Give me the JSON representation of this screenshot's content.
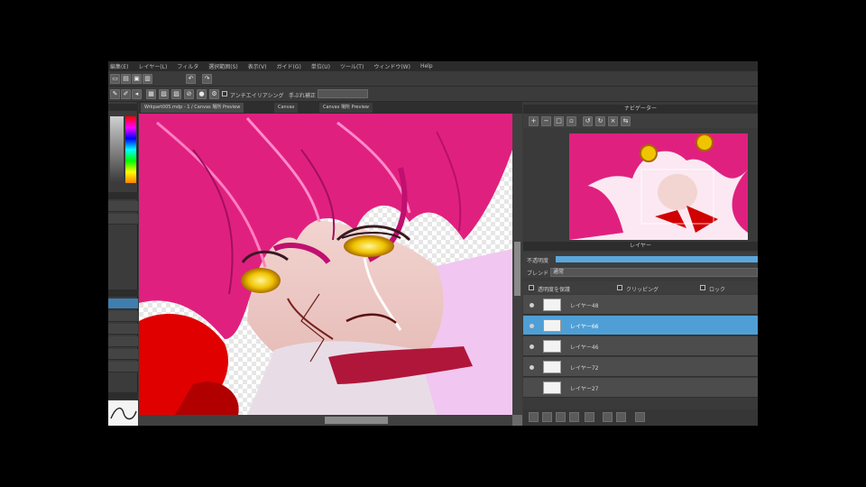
{
  "menu": {
    "items": [
      "編集(E)",
      "レイヤー(L)",
      "フィルタ",
      "選択範囲(S)",
      "表示(V)",
      "ガイド(G)",
      "単位(U)",
      "ツール(T)",
      "ウィンドウ(W)",
      "Help"
    ]
  },
  "toolbar": {
    "antialias_label": "アンチエイリアシング",
    "correction_label": "手ぶれ補正"
  },
  "canvas": {
    "tabs": [
      "Wrkpart005.mdp - 1 / Canvas 場所 Preview",
      "Canvas",
      "Canvas 場所 Preview"
    ]
  },
  "navigator": {
    "title": "ナビゲーター"
  },
  "layers": {
    "title": "レイヤー",
    "opacity_label": "不透明度",
    "blend_label": "ブレンド",
    "blend_value": "通常",
    "protect_alpha_label": "透明度を保護",
    "clipping_label": "クリッピング",
    "lock_label": "ロック",
    "items": [
      {
        "name": "レイヤー48",
        "selected": false
      },
      {
        "name": "レイヤー66",
        "selected": true
      },
      {
        "name": "レイヤー46",
        "selected": false
      },
      {
        "name": "レイヤー72",
        "selected": false
      },
      {
        "name": "レイヤー27",
        "selected": false
      }
    ]
  },
  "colors": {
    "accent": "#4f9fd6",
    "panel": "#3a3a3a",
    "hair": "#e0207f"
  }
}
